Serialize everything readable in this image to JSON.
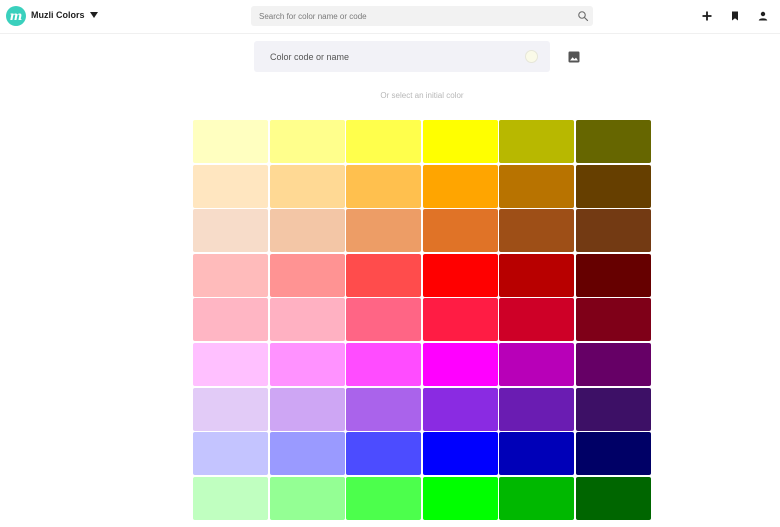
{
  "header": {
    "logo_text": "m",
    "brand": "Muzli Colors",
    "search_placeholder": "Search for color name or code",
    "actions": [
      "plus-icon",
      "bookmark-icon",
      "user-icon"
    ]
  },
  "picker": {
    "placeholder": "Color code or name",
    "preview_color": "#fafae8"
  },
  "hint": "Or select an initial color",
  "palette": [
    [
      "#ffffc0",
      "#ffff8c",
      "#ffff4c",
      "#ffff00",
      "#b8b800",
      "#666600"
    ],
    [
      "#ffe6c0",
      "#ffd994",
      "#ffc04e",
      "#ffa500",
      "#b87300",
      "#663f00"
    ],
    [
      "#f7dcc9",
      "#f3c6a6",
      "#ed9d66",
      "#e07327",
      "#9e4f17",
      "#733a13"
    ],
    [
      "#ffbbbb",
      "#ff9393",
      "#ff4c4c",
      "#ff0000",
      "#b80000",
      "#660000"
    ],
    [
      "#ffb6c4",
      "#ffb1c2",
      "#ff6585",
      "#ff1c44",
      "#ce0027",
      "#7f0018"
    ],
    [
      "#ffc0ff",
      "#ff92ff",
      "#ff4cff",
      "#ff00ff",
      "#b800b8",
      "#660066"
    ],
    [
      "#e2cbf7",
      "#cea6f4",
      "#aa63eb",
      "#8a2be2",
      "#6a1cb2",
      "#3d1066"
    ],
    [
      "#c4c4ff",
      "#9a9aff",
      "#4c4cff",
      "#0000ff",
      "#0000b8",
      "#000066"
    ],
    [
      "#c0ffc0",
      "#94ff94",
      "#4cff4c",
      "#00ff00",
      "#00b800",
      "#006600"
    ]
  ]
}
